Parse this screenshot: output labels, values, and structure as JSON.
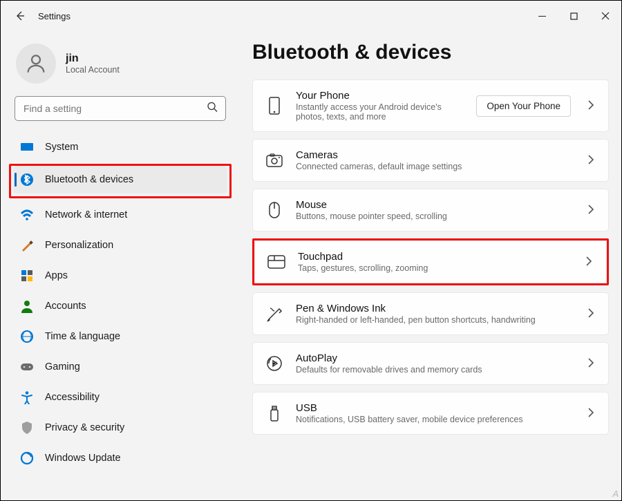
{
  "window": {
    "title": "Settings"
  },
  "user": {
    "name": "jin",
    "account_type": "Local Account"
  },
  "search": {
    "placeholder": "Find a setting"
  },
  "sidebar": {
    "items": [
      {
        "label": "System"
      },
      {
        "label": "Bluetooth & devices"
      },
      {
        "label": "Network & internet"
      },
      {
        "label": "Personalization"
      },
      {
        "label": "Apps"
      },
      {
        "label": "Accounts"
      },
      {
        "label": "Time & language"
      },
      {
        "label": "Gaming"
      },
      {
        "label": "Accessibility"
      },
      {
        "label": "Privacy & security"
      },
      {
        "label": "Windows Update"
      }
    ],
    "selected_index": 1,
    "highlighted_index": 1
  },
  "page": {
    "title": "Bluetooth & devices",
    "highlighted_index": 3,
    "cards": [
      {
        "title": "Your Phone",
        "sub": "Instantly access your Android device's photos, texts, and more",
        "action_label": "Open Your Phone"
      },
      {
        "title": "Cameras",
        "sub": "Connected cameras, default image settings"
      },
      {
        "title": "Mouse",
        "sub": "Buttons, mouse pointer speed, scrolling"
      },
      {
        "title": "Touchpad",
        "sub": "Taps, gestures, scrolling, zooming"
      },
      {
        "title": "Pen & Windows Ink",
        "sub": "Right-handed or left-handed, pen button shortcuts, handwriting"
      },
      {
        "title": "AutoPlay",
        "sub": "Defaults for removable drives and memory cards"
      },
      {
        "title": "USB",
        "sub": "Notifications, USB battery saver, mobile device preferences"
      }
    ]
  }
}
